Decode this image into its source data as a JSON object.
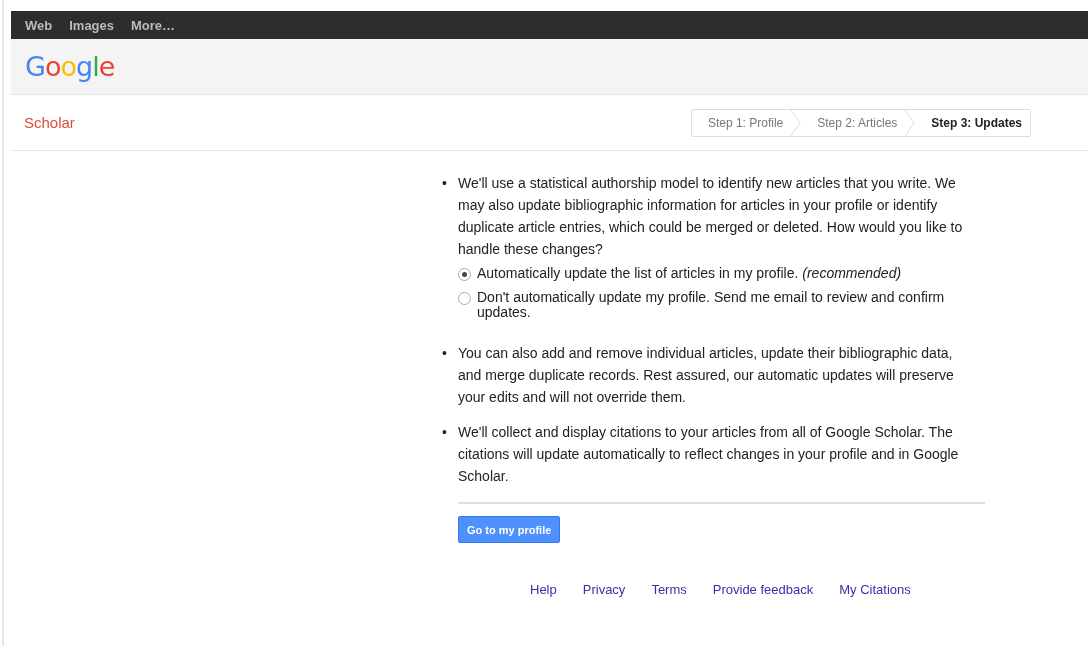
{
  "top_nav": [
    {
      "label": "Web"
    },
    {
      "label": "Images"
    },
    {
      "label": "More…"
    }
  ],
  "logo": "Google",
  "section_title": "Scholar",
  "steps": [
    {
      "label": "Step 1: Profile",
      "selected": false
    },
    {
      "label": "Step 2: Articles",
      "selected": false
    },
    {
      "label": "Step 3: Updates",
      "selected": true
    }
  ],
  "bullets": [
    {
      "marker": "•",
      "text": "We'll use a statistical authorship model to identify new articles that you write. We may also update bibliographic information for articles in your profile or identify duplicate article entries, which could be merged or deleted. How would you like to handle these changes?",
      "options": [
        {
          "label": "Automatically update the list of articles in my profile. *(recommended)*",
          "selected": true
        },
        {
          "label": "Don't automatically update my profile. Send me email to review and confirm updates.",
          "selected": false
        }
      ]
    },
    {
      "marker": "•",
      "text": "You can also add and remove individual articles, update their bibliographic data, and merge duplicate records. Rest assured, our automatic updates will preserve your edits and will not override them."
    },
    {
      "marker": "•",
      "text": "We'll collect and display citations to your articles from all of Google Scholar. The citations will update automatically to reflect changes in your profile and in Google Scholar."
    }
  ],
  "primary_button": "Go to my profile",
  "footer_links": [
    "Help",
    "Privacy",
    "Terms",
    "Provide feedback",
    "My Citations"
  ]
}
